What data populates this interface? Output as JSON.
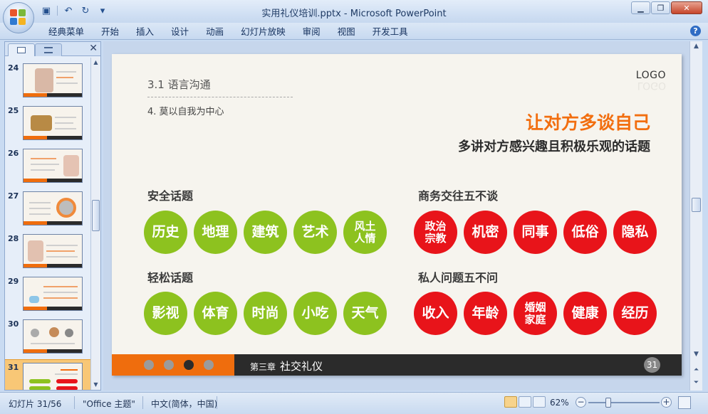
{
  "window": {
    "title": "实用礼仪培训.pptx - Microsoft PowerPoint",
    "minimize_icon": "minimize-icon",
    "restore_icon": "restore-icon",
    "close_icon": "close-icon"
  },
  "quick_access": [
    {
      "name": "save-icon",
      "glyph": "▣"
    },
    {
      "name": "undo-icon",
      "glyph": "↶"
    },
    {
      "name": "redo-icon",
      "glyph": "↻"
    },
    {
      "name": "customize-icon",
      "glyph": "▾"
    }
  ],
  "ribbon": {
    "tabs": [
      "经典菜单",
      "开始",
      "插入",
      "设计",
      "动画",
      "幻灯片放映",
      "审阅",
      "视图",
      "开发工具"
    ],
    "help_glyph": "?"
  },
  "slide_panel": {
    "thumbnails": [
      {
        "number": "24"
      },
      {
        "number": "25"
      },
      {
        "number": "26"
      },
      {
        "number": "27"
      },
      {
        "number": "28"
      },
      {
        "number": "29"
      },
      {
        "number": "30"
      },
      {
        "number": "31",
        "selected": true
      }
    ]
  },
  "slide": {
    "section_title": "3.1  语言沟通",
    "sub_title": "4. 莫以自我为中心",
    "logo": "LOGO",
    "headline": "让对方多谈自己",
    "subheadline": "多讲对方感兴趣且积极乐观的话题",
    "groups": {
      "safe": {
        "label": "安全话题",
        "items": [
          "历史",
          "地理",
          "建筑",
          "艺术",
          "风土\n人情"
        ]
      },
      "business": {
        "label": "商务交往五不谈",
        "items": [
          "政治\n宗教",
          "机密",
          "同事",
          "低俗",
          "隐私"
        ]
      },
      "casual": {
        "label": "轻松话题",
        "items": [
          "影视",
          "体育",
          "时尚",
          "小吃",
          "天气"
        ]
      },
      "private": {
        "label": "私人问题五不问",
        "items": [
          "收入",
          "年龄",
          "婚姻\n家庭",
          "健康",
          "经历"
        ]
      }
    },
    "footer": {
      "chapter_prefix": "第三章",
      "chapter_title": "社交礼仪",
      "page_number": "31",
      "active_dot": 3
    },
    "colors": {
      "orange": "#ef6d0d",
      "green": "#8dc21f",
      "red": "#e8141a",
      "dark": "#2b2b2b"
    }
  },
  "status": {
    "slide_info": "幻灯片 31/56",
    "theme": "\"Office 主题\"",
    "language": "中文(简体，中国)",
    "zoom": "62%",
    "zoom_fraction": 0.26
  }
}
